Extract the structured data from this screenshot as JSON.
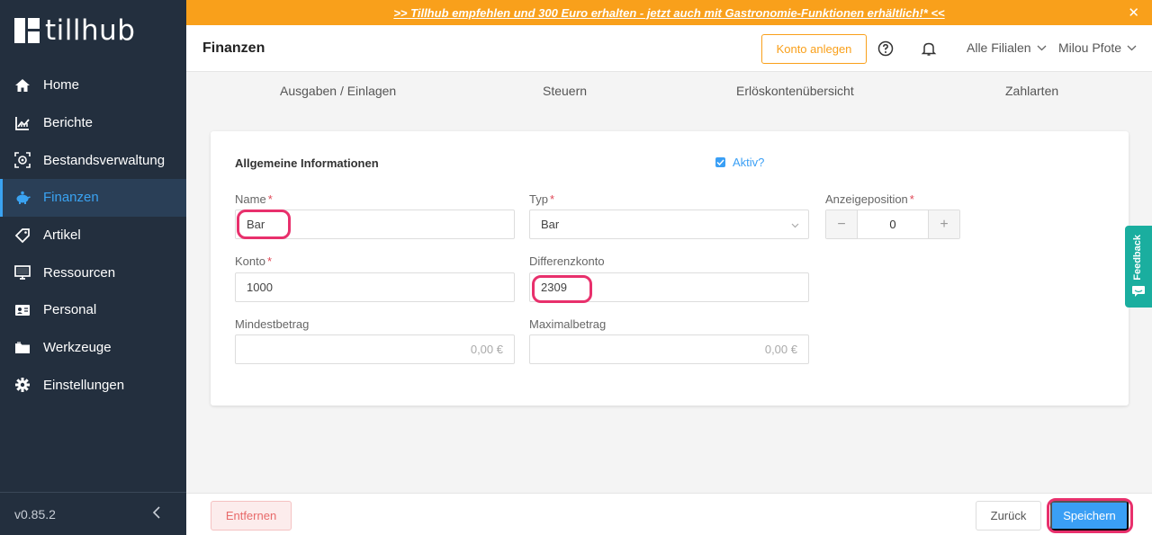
{
  "app": {
    "logo_text": "tillhub",
    "version": "v0.85.2"
  },
  "banner": {
    "text": ">> Tillhub empfehlen und 300 Euro erhalten - jetzt auch mit Gastronomie-Funktionen erhältlich!* <<",
    "close": "✕"
  },
  "sidebar": {
    "items": [
      {
        "label": "Home",
        "icon": "home-icon"
      },
      {
        "label": "Berichte",
        "icon": "chart-icon"
      },
      {
        "label": "Bestandsverwaltung",
        "icon": "inventory-icon"
      },
      {
        "label": "Finanzen",
        "icon": "piggy-bank-icon",
        "active": true
      },
      {
        "label": "Artikel",
        "icon": "tag-icon"
      },
      {
        "label": "Ressourcen",
        "icon": "monitor-icon"
      },
      {
        "label": "Personal",
        "icon": "id-card-icon"
      },
      {
        "label": "Werkzeuge",
        "icon": "folder-icon"
      },
      {
        "label": "Einstellungen",
        "icon": "gear-icon"
      }
    ],
    "collapse_icon": "chevron-left-icon"
  },
  "header": {
    "title": "Finanzen",
    "konto_button": "Konto anlegen",
    "branch_select": "Alle Filialen",
    "user_select": "Milou Pfote"
  },
  "tabs": [
    "Ausgaben / Einlagen",
    "Steuern",
    "Erlöskontenübersicht",
    "Zahlarten"
  ],
  "form": {
    "section_title": "Allgemeine Informationen",
    "active_label": "Aktiv?",
    "active_checked": true,
    "required_mark": "*",
    "name": {
      "label": "Name",
      "value": "Bar"
    },
    "typ": {
      "label": "Typ",
      "value": "Bar"
    },
    "anzeigeposition": {
      "label": "Anzeigeposition",
      "value": "0",
      "minus": "−",
      "plus": "+"
    },
    "konto": {
      "label": "Konto",
      "value": "1000"
    },
    "differenzkonto": {
      "label": "Differenzkonto",
      "value": "2309"
    },
    "mindestbetrag": {
      "label": "Mindestbetrag",
      "placeholder": "0,00 €"
    },
    "maximalbetrag": {
      "label": "Maximalbetrag",
      "placeholder": "0,00 €"
    }
  },
  "feedback": {
    "label": "Feedback"
  },
  "footer": {
    "remove_button": "Entfernen",
    "back_button": "Zurück",
    "save_button": "Speichern"
  },
  "colors": {
    "sidebar_bg": "#232f3e",
    "accent_blue": "#3a9ff5",
    "banner_orange": "#f9a01b",
    "highlight_pink": "#e8306c",
    "feedback_teal": "#1aae9f"
  }
}
